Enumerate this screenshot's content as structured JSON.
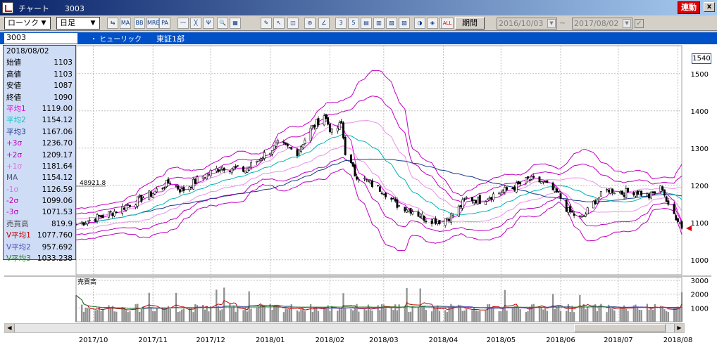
{
  "window": {
    "title": "チャート",
    "code": "3003",
    "renketsu_label": "連動",
    "close_label": "x"
  },
  "toolbar": {
    "chart_type": "ローソク",
    "period_type": "日足",
    "kikan_label": "期間",
    "date_from": "2016/10/03",
    "date_to": "2017/08/02",
    "tilde": "~",
    "check": "✓",
    "tools": [
      {
        "name": "compare-tool-icon",
        "glyph": "⇆"
      },
      {
        "name": "ma-icon",
        "glyph": "MA"
      },
      {
        "name": "bb-icon",
        "glyph": "BB"
      },
      {
        "name": "mre-icon",
        "glyph": "MRE"
      },
      {
        "name": "pa-icon",
        "glyph": "PA"
      },
      {
        "name": "line-chart-icon",
        "glyph": "〰"
      },
      {
        "name": "trend-tool-icon",
        "glyph": "╳"
      },
      {
        "name": "fibonacci-icon",
        "glyph": "Ψ"
      },
      {
        "name": "zoom-icon",
        "glyph": "🔍"
      },
      {
        "name": "calc-icon",
        "glyph": "▦"
      },
      {
        "name": "pen-icon",
        "glyph": "✎"
      },
      {
        "name": "cursor-icon",
        "glyph": "↖"
      },
      {
        "name": "eraser-icon",
        "glyph": "◫"
      },
      {
        "name": "gann-icon",
        "glyph": "⊛"
      },
      {
        "name": "angle-icon",
        "glyph": "∠"
      },
      {
        "name": "chart1-icon",
        "glyph": "3"
      },
      {
        "name": "chart2-icon",
        "glyph": "5"
      },
      {
        "name": "chart3-icon",
        "glyph": "▤"
      },
      {
        "name": "chart4-icon",
        "glyph": "▥"
      },
      {
        "name": "chart5-icon",
        "glyph": "▧"
      },
      {
        "name": "chart6-icon",
        "glyph": "▨"
      },
      {
        "name": "chart7-icon",
        "glyph": "◑"
      },
      {
        "name": "chart8-icon",
        "glyph": "◈"
      },
      {
        "name": "chart9-icon",
        "glyph": "↕"
      },
      {
        "name": "all-icon",
        "glyph": "ALL"
      }
    ]
  },
  "info_bar": {
    "code": "3003",
    "name": "・ ヒューリック",
    "market": "東証1部"
  },
  "data_panel": {
    "rows": [
      {
        "label": "2018/08/02",
        "value": "",
        "color": "#000000"
      },
      {
        "label": "始値",
        "value": "1103",
        "color": "#000000"
      },
      {
        "label": "高値",
        "value": "1103",
        "color": "#000000"
      },
      {
        "label": "安値",
        "value": "1087",
        "color": "#000000"
      },
      {
        "label": "終値",
        "value": "1090",
        "color": "#000000"
      },
      {
        "label": "平均1",
        "value": "1119.00",
        "color": "#e000e0"
      },
      {
        "label": "平均2",
        "value": "1154.12",
        "color": "#00c8c8"
      },
      {
        "label": "平均3",
        "value": "1167.06",
        "color": "#1a3a8a"
      },
      {
        "label": "+3σ",
        "value": "1236.70",
        "color": "#c000c0"
      },
      {
        "label": "+2σ",
        "value": "1209.17",
        "color": "#c000c0"
      },
      {
        "label": "+1σ",
        "value": "1181.64",
        "color": "#e070e0"
      },
      {
        "label": "MA",
        "value": "1154.12",
        "color": "#505080"
      },
      {
        "label": "-1σ",
        "value": "1126.59",
        "color": "#e070e0"
      },
      {
        "label": "-2σ",
        "value": "1099.06",
        "color": "#c000c0"
      },
      {
        "label": "-3σ",
        "value": "1071.53",
        "color": "#c000c0"
      },
      {
        "label": "売買高",
        "value": "819.9",
        "color": "#505050"
      },
      {
        "label": "V平均1",
        "value": "1077.760",
        "color": "#c00000"
      },
      {
        "label": "V平均2",
        "value": "957.692",
        "color": "#5050c0"
      },
      {
        "label": "V平均3",
        "value": "1033.238",
        "color": "#208020"
      }
    ]
  },
  "price_box": "1540",
  "annotation": "48921.8",
  "colors": {
    "candle_up": "#ffffff",
    "candle_down": "#000000",
    "band_3": "#c000c0",
    "band_2": "#c000c0",
    "band_1": "#e890e8",
    "ma1": "#e000e0",
    "ma2": "#00b4b4",
    "ma3": "#1a3a8a",
    "grid": "#c0c0c0",
    "vol_bar": "#909090",
    "vma1": "#c00000",
    "vma2": "#5050c0",
    "vma3": "#208020"
  },
  "chart_data": [
    {
      "type": "candlestick",
      "title": "",
      "y_ticks": [
        1000,
        1100,
        1200,
        1300,
        1400,
        1500
      ],
      "ylim": [
        960,
        1560
      ],
      "x_ticks": [
        "2017/10",
        "2017/11",
        "2017/12",
        "2018/01",
        "2018/02",
        "2018/03",
        "2018/04",
        "2018/05",
        "2018/06",
        "2018/07",
        "2018/08"
      ],
      "x_range": [
        "2017-09-22",
        "2018-08-03"
      ],
      "close_keypoints": [
        [
          "2017-09-22",
          1095
        ],
        [
          "2017-10-10",
          1125
        ],
        [
          "2017-10-24",
          1160
        ],
        [
          "2017-11-01",
          1180
        ],
        [
          "2017-11-10",
          1210
        ],
        [
          "2017-11-16",
          1185
        ],
        [
          "2017-11-27",
          1225
        ],
        [
          "2017-12-07",
          1250
        ],
        [
          "2017-12-19",
          1240
        ],
        [
          "2017-12-27",
          1275
        ],
        [
          "2018-01-05",
          1310
        ],
        [
          "2018-01-15",
          1290
        ],
        [
          "2018-01-22",
          1350
        ],
        [
          "2018-01-29",
          1390
        ],
        [
          "2018-02-02",
          1340
        ],
        [
          "2018-02-07",
          1365
        ],
        [
          "2018-02-09",
          1290
        ],
        [
          "2018-02-14",
          1230
        ],
        [
          "2018-02-22",
          1205
        ],
        [
          "2018-03-01",
          1185
        ],
        [
          "2018-03-07",
          1150
        ],
        [
          "2018-03-15",
          1135
        ],
        [
          "2018-03-23",
          1110
        ],
        [
          "2018-03-30",
          1105
        ],
        [
          "2018-04-06",
          1120
        ],
        [
          "2018-04-13",
          1165
        ],
        [
          "2018-04-20",
          1160
        ],
        [
          "2018-04-27",
          1175
        ],
        [
          "2018-05-08",
          1195
        ],
        [
          "2018-05-15",
          1215
        ],
        [
          "2018-05-22",
          1210
        ],
        [
          "2018-05-31",
          1175
        ],
        [
          "2018-06-05",
          1130
        ],
        [
          "2018-06-12",
          1110
        ],
        [
          "2018-06-19",
          1160
        ],
        [
          "2018-06-26",
          1190
        ],
        [
          "2018-07-03",
          1180
        ],
        [
          "2018-07-10",
          1185
        ],
        [
          "2018-07-17",
          1170
        ],
        [
          "2018-07-24",
          1195
        ],
        [
          "2018-07-27",
          1140
        ],
        [
          "2018-08-01",
          1110
        ],
        [
          "2018-08-03",
          1090
        ]
      ],
      "volume": {
        "label": "売買高",
        "y_ticks": [
          1000,
          2000,
          3000
        ],
        "ylim": [
          0,
          3200
        ]
      }
    }
  ]
}
